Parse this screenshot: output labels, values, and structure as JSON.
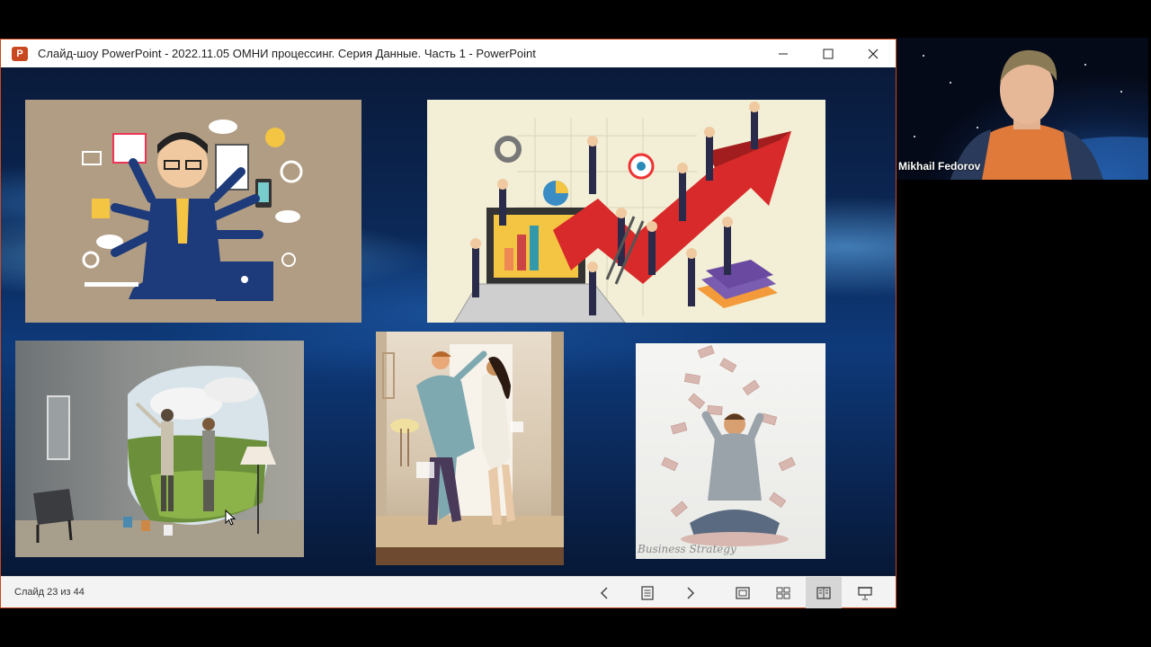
{
  "window": {
    "app_icon_letter": "P",
    "title": "Слайд-шоу PowerPoint  -  2022.11.05 ОМНИ процессинг. Серия Данные. Часть 1 - PowerPoint",
    "controls": {
      "minimize": "—",
      "maximize": "☐",
      "close": "✕"
    }
  },
  "slide": {
    "images": [
      {
        "name": "multitasking-businessman-illustration"
      },
      {
        "name": "business-growth-arrow-illustration"
      },
      {
        "name": "couple-painting-wall-landscape-photo"
      },
      {
        "name": "couple-dancing-illustration"
      },
      {
        "name": "man-throwing-money-photo",
        "watermark": "Business Strategy"
      }
    ]
  },
  "statusbar": {
    "slide_counter": "Слайд 23 из 44",
    "buttons": [
      {
        "name": "previous-slide",
        "icon": "chevron-left-icon",
        "glyph": "‹"
      },
      {
        "name": "slide-list",
        "icon": "notes-icon",
        "glyph": "▤"
      },
      {
        "name": "next-slide",
        "icon": "chevron-right-icon",
        "glyph": "›"
      },
      {
        "name": "normal-view",
        "icon": "normal-view-icon",
        "glyph": "▣"
      },
      {
        "name": "slide-sorter",
        "icon": "grid-icon",
        "glyph": "▦"
      },
      {
        "name": "reading-view",
        "icon": "book-icon",
        "glyph": "▥"
      },
      {
        "name": "slideshow-view",
        "icon": "projector-icon",
        "glyph": "⊓"
      }
    ]
  },
  "webcam": {
    "participant_name": "Mikhail Fedorov"
  },
  "colors": {
    "accent": "#c8481f",
    "slide_background": "#0b2a5a",
    "statusbar": "#f3f3f3"
  }
}
